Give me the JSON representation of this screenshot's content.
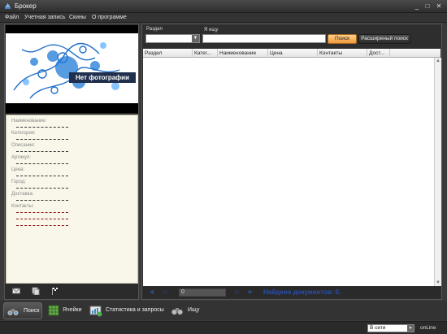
{
  "window": {
    "title": "Брокер",
    "minimize": "_",
    "maximize": "□",
    "close": "✕"
  },
  "menu": [
    "Файл",
    "Учетная запись",
    "Скины",
    "О программе"
  ],
  "photo": {
    "label": "Нет фотографии"
  },
  "details": [
    {
      "label": "Наименование:",
      "value": "----------------------------"
    },
    {
      "label": "Категория:",
      "value": "----------------------------"
    },
    {
      "label": "Описание:",
      "value": "----------------------------"
    },
    {
      "label": "Артикул:",
      "value": "----------------------------"
    },
    {
      "label": "Цена:",
      "value": "----------------------------"
    },
    {
      "label": "Город:",
      "value": "----------------------------"
    },
    {
      "label": "Доставка:",
      "value": "----------------------------"
    },
    {
      "label": "Контакты:",
      "value": "----------------------------"
    }
  ],
  "search": {
    "section_label": "Раздел",
    "section_value": "",
    "query_label": "Я ищу",
    "query_value": "",
    "search_button": "Поиск",
    "advanced_button": "Расширеный поиск"
  },
  "table": {
    "columns": [
      "Раздел",
      "Катег...",
      "Наименование",
      "Цена",
      "Контакты",
      "Дост..."
    ],
    "rows": []
  },
  "pager": {
    "page_value": "0",
    "found_text": "Найдено документов: 0."
  },
  "tabs": [
    {
      "label": "Поиск",
      "icon": "binoculars-icon",
      "active": true
    },
    {
      "label": "Ячейки",
      "icon": "cells-icon",
      "active": false
    },
    {
      "label": "Статистика и запросы",
      "icon": "statistics-icon",
      "active": false
    },
    {
      "label": "Ищу",
      "icon": "wanted-icon",
      "active": false
    }
  ],
  "status": {
    "network_value": "В сети",
    "online_label": "onLine"
  },
  "colors": {
    "accent_orange": "#f19b3e",
    "found_blue": "#2b4fa8",
    "panel_bg": "#2e2e2e"
  }
}
